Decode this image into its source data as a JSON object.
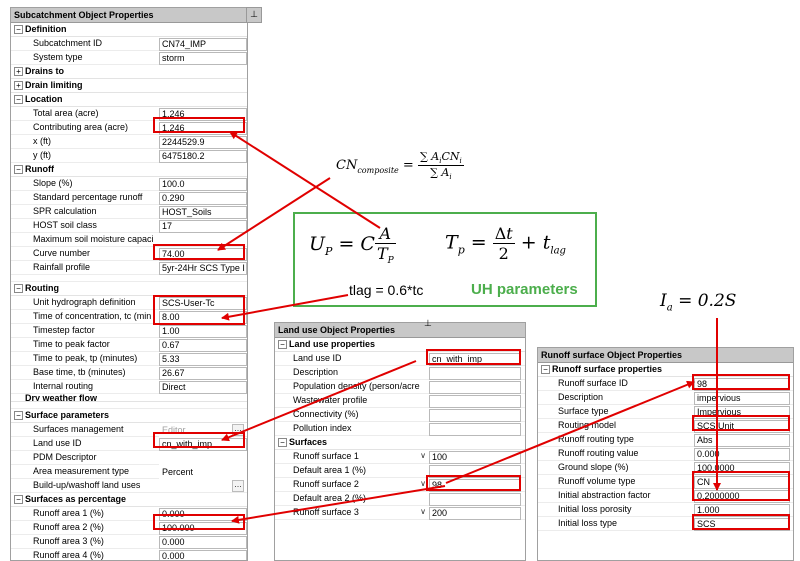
{
  "subcatchment": {
    "title": "Subcatchment Object Properties",
    "sections": {
      "definition": "Definition",
      "drains_to": "Drains to",
      "drain_limiting": "Drain limiting",
      "location": "Location",
      "runoff": "Runoff",
      "routing": "Routing",
      "dry_weather": "Dry weather flow",
      "surface_params": "Surface parameters",
      "surfaces_pct": "Surfaces as percentage"
    },
    "rows": {
      "subcatchment_id": {
        "label": "Subcatchment ID",
        "value": "CN74_IMP"
      },
      "system_type": {
        "label": "System type",
        "value": "storm"
      },
      "total_area": {
        "label": "Total area (acre)",
        "value": "1.246"
      },
      "contributing_area": {
        "label": "Contributing area (acre)",
        "value": "1.246"
      },
      "x": {
        "label": "x (ft)",
        "value": "2244529.9"
      },
      "y": {
        "label": "y (ft)",
        "value": "6475180.2"
      },
      "slope": {
        "label": "Slope (%)",
        "value": "100.0"
      },
      "std_pct_runoff": {
        "label": "Standard percentage runoff",
        "value": "0.290"
      },
      "spr_calc": {
        "label": "SPR calculation",
        "value": "HOST_Soils"
      },
      "host_soil": {
        "label": "HOST soil class",
        "value": "17"
      },
      "max_soil": {
        "label": "Maximum soil moisture capaci",
        "value": ""
      },
      "curve_number": {
        "label": "Curve number",
        "value": "74.00"
      },
      "rainfall_profile": {
        "label": "Rainfall profile",
        "value": "5yr-24Hr SCS Type I"
      },
      "uh_def": {
        "label": "Unit hydrograph definition",
        "value": "SCS-User-Tc"
      },
      "tc": {
        "label": "Time of concentration, tc (min",
        "value": "8.00"
      },
      "timestep": {
        "label": "Timestep factor",
        "value": "1.00"
      },
      "ttp_factor": {
        "label": "Time to peak factor",
        "value": "0.67"
      },
      "ttp": {
        "label": "Time to peak, tp (minutes)",
        "value": "5.33"
      },
      "base_time": {
        "label": "Base time, tb (minutes)",
        "value": "26.67"
      },
      "internal_routing": {
        "label": "Internal routing",
        "value": "Direct"
      },
      "surfaces_mgmt": {
        "label": "Surfaces management",
        "value": "Editor"
      },
      "land_use_id": {
        "label": "Land use ID",
        "value": "cn_with_imp"
      },
      "pdm": {
        "label": "PDM Descriptor",
        "value": ""
      },
      "area_meas": {
        "label": "Area measurement type",
        "value": "Percent"
      },
      "buildup": {
        "label": "Build-up/washoff land uses",
        "value": ""
      },
      "ra1": {
        "label": "Runoff area 1 (%)",
        "value": "0.000"
      },
      "ra2": {
        "label": "Runoff area 2 (%)",
        "value": "100.000"
      },
      "ra3": {
        "label": "Runoff area 3 (%)",
        "value": "0.000"
      },
      "ra4": {
        "label": "Runoff area 4 (%)",
        "value": "0.000"
      }
    }
  },
  "landuse": {
    "title": "Land use Object Properties",
    "sections": {
      "props": "Land use properties",
      "surfaces": "Surfaces"
    },
    "rows": {
      "id": {
        "label": "Land use ID",
        "value": "cn_with_imp"
      },
      "desc": {
        "label": "Description",
        "value": ""
      },
      "pop": {
        "label": "Population density (person/acre",
        "value": ""
      },
      "ww": {
        "label": "Wastewater profile",
        "value": ""
      },
      "conn": {
        "label": "Connectivity (%)",
        "value": ""
      },
      "poll": {
        "label": "Pollution index",
        "value": ""
      },
      "rs1": {
        "label": "Runoff surface 1",
        "value": "100"
      },
      "dra1": {
        "label": "Default area 1 (%)",
        "value": ""
      },
      "rs2": {
        "label": "Runoff surface 2",
        "value": "98"
      },
      "dra2": {
        "label": "Default area 2 (%)",
        "value": ""
      },
      "rs3": {
        "label": "Runoff surface 3",
        "value": "200"
      }
    }
  },
  "runoff_surface": {
    "title": "Runoff surface Object Properties",
    "sections": {
      "props": "Runoff surface properties"
    },
    "rows": {
      "id": {
        "label": "Runoff surface ID",
        "value": "98"
      },
      "desc": {
        "label": "Description",
        "value": "impervious"
      },
      "stype": {
        "label": "Surface type",
        "value": "Impervious"
      },
      "routing_model": {
        "label": "Routing model",
        "value": "SCS Unit"
      },
      "rr_type": {
        "label": "Runoff routing type",
        "value": "Abs"
      },
      "rr_value": {
        "label": "Runoff routing value",
        "value": "0.000"
      },
      "ground_slope": {
        "label": "Ground slope (%)",
        "value": "100.0000"
      },
      "rv_type": {
        "label": "Runoff volume type",
        "value": "CN"
      },
      "iaf": {
        "label": "Initial abstraction factor",
        "value": "0.2000000"
      },
      "il_porosity": {
        "label": "Initial loss porosity",
        "value": "1.000"
      },
      "il_type": {
        "label": "Initial loss type",
        "value": "SCS"
      }
    }
  },
  "annotations": {
    "tlag": "tlag = 0.6*tc",
    "uh_params": "UH parameters",
    "cn_composite_lhs": "CN",
    "cn_composite_sub": "composite",
    "ia_formula": "I",
    "ia_rest": " = 0.2S"
  },
  "colors": {
    "highlight": "#e00000",
    "green": "#4cae4c",
    "title_bar": "#c8c8c8"
  }
}
